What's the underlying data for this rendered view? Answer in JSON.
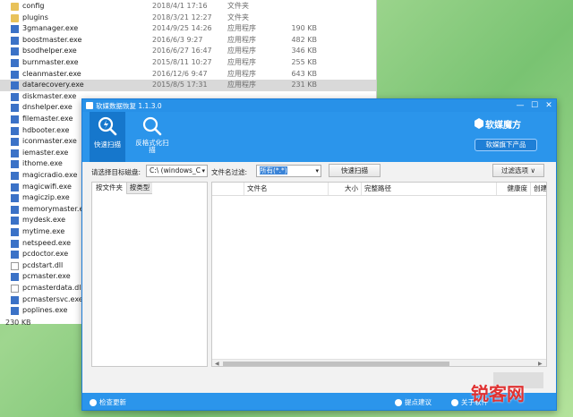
{
  "explorer": {
    "files": [
      {
        "name": "config",
        "date": "2018/4/1 17:16",
        "type": "文件夹",
        "size": "",
        "icon": "folder-icon"
      },
      {
        "name": "plugins",
        "date": "2018/3/21 12:27",
        "type": "文件夹",
        "size": "",
        "icon": "folder-icon"
      },
      {
        "name": "3gmanager.exe",
        "date": "2014/9/25 14:26",
        "type": "应用程序",
        "size": "190 KB",
        "icon": "exe-icon"
      },
      {
        "name": "boostmaster.exe",
        "date": "2016/6/3 9:27",
        "type": "应用程序",
        "size": "482 KB",
        "icon": "exe-icon"
      },
      {
        "name": "bsodhelper.exe",
        "date": "2016/6/27 16:47",
        "type": "应用程序",
        "size": "346 KB",
        "icon": "exe-icon"
      },
      {
        "name": "burnmaster.exe",
        "date": "2015/8/11 10:27",
        "type": "应用程序",
        "size": "255 KB",
        "icon": "exe-icon"
      },
      {
        "name": "cleanmaster.exe",
        "date": "2016/12/6 9:47",
        "type": "应用程序",
        "size": "643 KB",
        "icon": "exe-icon"
      },
      {
        "name": "datarecovery.exe",
        "date": "2015/8/5 17:31",
        "type": "应用程序",
        "size": "231 KB",
        "icon": "exe-icon",
        "selected": true
      },
      {
        "name": "diskmaster.exe",
        "date": "",
        "type": "",
        "size": "",
        "icon": "exe-icon"
      },
      {
        "name": "dnshelper.exe",
        "date": "",
        "type": "",
        "size": "",
        "icon": "exe-icon"
      },
      {
        "name": "filemaster.exe",
        "date": "",
        "type": "",
        "size": "",
        "icon": "exe-icon"
      },
      {
        "name": "hdbooter.exe",
        "date": "",
        "type": "",
        "size": "",
        "icon": "exe-icon"
      },
      {
        "name": "iconmaster.exe",
        "date": "",
        "type": "",
        "size": "",
        "icon": "exe-icon"
      },
      {
        "name": "iemaster.exe",
        "date": "",
        "type": "",
        "size": "",
        "icon": "exe-icon"
      },
      {
        "name": "ithome.exe",
        "date": "",
        "type": "",
        "size": "",
        "icon": "exe-icon"
      },
      {
        "name": "magicradio.exe",
        "date": "",
        "type": "",
        "size": "",
        "icon": "exe-icon"
      },
      {
        "name": "magicwifi.exe",
        "date": "",
        "type": "",
        "size": "",
        "icon": "exe-icon"
      },
      {
        "name": "magiczip.exe",
        "date": "",
        "type": "",
        "size": "",
        "icon": "exe-icon"
      },
      {
        "name": "memorymaster.exe",
        "date": "",
        "type": "",
        "size": "",
        "icon": "exe-icon"
      },
      {
        "name": "mydesk.exe",
        "date": "",
        "type": "",
        "size": "",
        "icon": "exe-icon"
      },
      {
        "name": "mytime.exe",
        "date": "",
        "type": "",
        "size": "",
        "icon": "exe-icon"
      },
      {
        "name": "netspeed.exe",
        "date": "",
        "type": "",
        "size": "",
        "icon": "exe-icon"
      },
      {
        "name": "pcdoctor.exe",
        "date": "",
        "type": "",
        "size": "",
        "icon": "exe-icon"
      },
      {
        "name": "pcdstart.dll",
        "date": "",
        "type": "",
        "size": "",
        "icon": "dll-icon"
      },
      {
        "name": "pcmaster.exe",
        "date": "",
        "type": "",
        "size": "",
        "icon": "exe-icon"
      },
      {
        "name": "pcmasterdata.dll",
        "date": "",
        "type": "",
        "size": "",
        "icon": "dll-icon"
      },
      {
        "name": "pcmastersvc.exe",
        "date": "",
        "type": "",
        "size": "",
        "icon": "exe-icon"
      },
      {
        "name": "poplines.exe",
        "date": "",
        "type": "",
        "size": "",
        "icon": "exe-icon"
      }
    ],
    "status_size": "230 KB"
  },
  "app": {
    "title": "软媒数据恢复 1.1.3.0",
    "window_buttons": [
      "—",
      "☐",
      "✕"
    ],
    "toolbar": {
      "quick_scan": "快速扫描",
      "deep_scan": "反格式化扫描"
    },
    "brand": {
      "name": "软媒魔方",
      "sub": "软媒旗下产品"
    },
    "options": {
      "disk_label": "请选择目标磁盘:",
      "disk_value": "C:\\  (windows_C",
      "filter_label": "文件名过滤:",
      "filter_value": "所有(*.*)",
      "scan_button": "快速扫描",
      "filter_options_button": "过滤选项"
    },
    "left_tabs": [
      "按文件夹",
      "按类型"
    ],
    "columns": [
      "",
      "文件名",
      "大小",
      "完整路径",
      "健康度",
      "创建"
    ],
    "statusbar": {
      "check_update": "检查更新",
      "suggest": "提点建议",
      "about": "关于软件"
    }
  },
  "watermark": "锐客网",
  "colors": {
    "accent": "#2b95eb",
    "accent_dark": "#1677cc",
    "watermark": "#e03232"
  }
}
